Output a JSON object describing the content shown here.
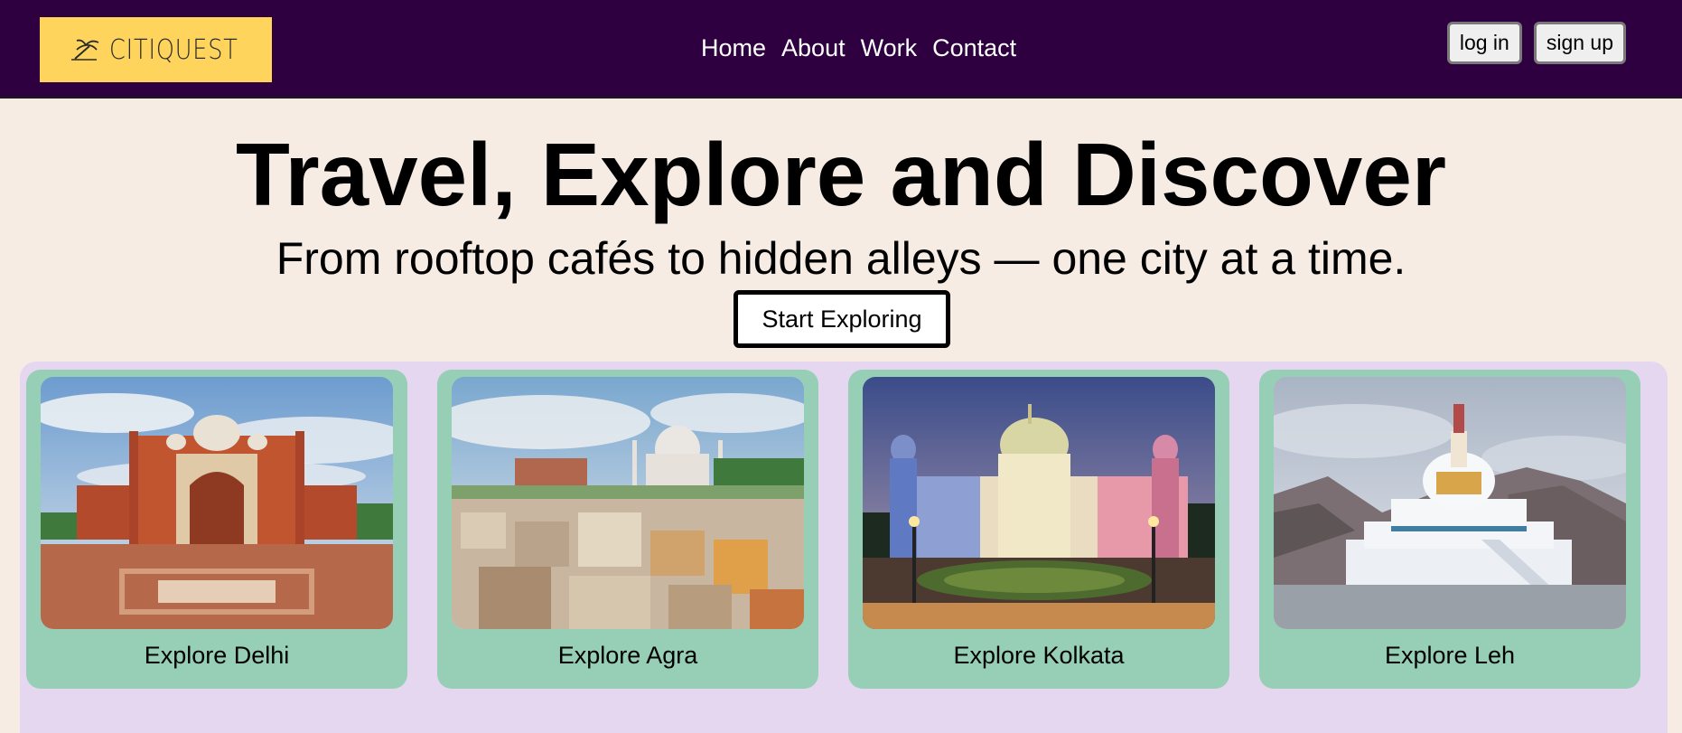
{
  "brand": {
    "logo_text": "CITIQUEST"
  },
  "nav": {
    "links": [
      "Home",
      "About",
      "Work",
      "Contact"
    ]
  },
  "auth": {
    "login_label": "log in",
    "signup_label": "sign up"
  },
  "hero": {
    "title": "Travel, Explore and Discover",
    "subtitle": "From rooftop cafés to hidden alleys — one city at a time.",
    "cta_label": "Start Exploring"
  },
  "cities": [
    {
      "label": "Explore Delhi",
      "image": "red-sandstone-monument-photo"
    },
    {
      "label": "Explore Agra",
      "image": "taj-mahal-cityscape-photo"
    },
    {
      "label": "Explore Kolkata",
      "image": "victoria-memorial-night-photo"
    },
    {
      "label": "Explore Leh",
      "image": "shanti-stupa-mountains-photo"
    }
  ],
  "colors": {
    "nav_bg": "#2e0040",
    "logo_bg": "#ffd45c",
    "page_bg": "#f7ece3",
    "cards_bg": "#e6d7f1",
    "card_bg": "#96cfb5"
  }
}
